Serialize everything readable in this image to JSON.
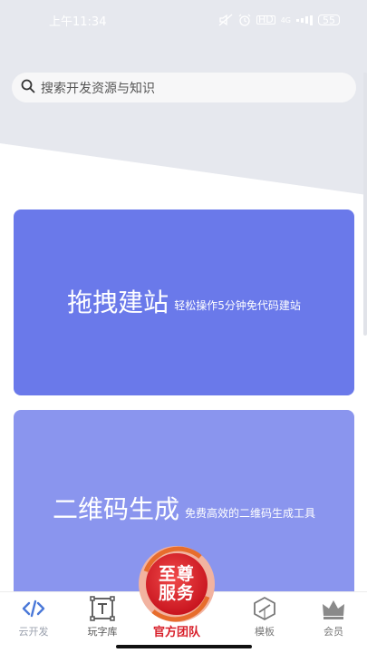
{
  "status_bar": {
    "time": "上午11:34",
    "network_label": "4G",
    "hd_label": "HD",
    "battery_label": "55"
  },
  "search": {
    "placeholder": "搜索开发资源与知识",
    "icon": "search-icon"
  },
  "cards": [
    {
      "title": "拖拽建站",
      "subtitle": "轻松操作5分钟免代码建站"
    },
    {
      "title": "二维码生成",
      "subtitle": "免费高效的二维码生成工具"
    }
  ],
  "bottom_nav": {
    "items": [
      {
        "label": "云开发",
        "icon": "code-icon"
      },
      {
        "label": "玩字库",
        "icon": "text-box-icon"
      },
      {
        "label": "官方团队",
        "icon": "badge-icon"
      },
      {
        "label": "模板",
        "icon": "cube-icon"
      },
      {
        "label": "会员",
        "icon": "crown-icon"
      }
    ],
    "badge_line1": "至尊",
    "badge_line2": "服务"
  },
  "colors": {
    "header_bg": "#e6e8ee",
    "card_1": "#6a79ea",
    "card_2": "#8a95ee",
    "badge_red": "#d8202b"
  }
}
